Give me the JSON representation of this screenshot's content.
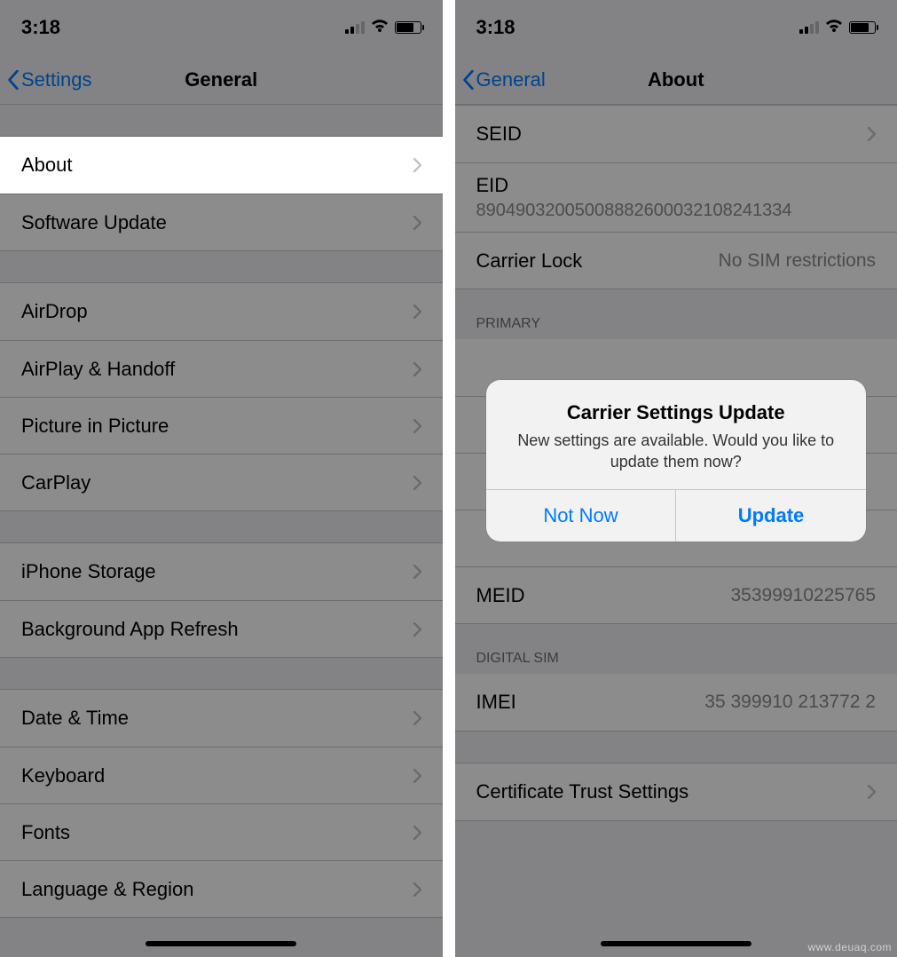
{
  "status": {
    "time": "3:18"
  },
  "left": {
    "back": "Settings",
    "title": "General",
    "rows": {
      "about": "About",
      "software_update": "Software Update",
      "airdrop": "AirDrop",
      "airplay": "AirPlay & Handoff",
      "pip": "Picture in Picture",
      "carplay": "CarPlay",
      "storage": "iPhone Storage",
      "refresh": "Background App Refresh",
      "datetime": "Date & Time",
      "keyboard": "Keyboard",
      "fonts": "Fonts",
      "lang": "Language & Region"
    }
  },
  "right": {
    "back": "General",
    "title": "About",
    "rows": {
      "seid": "SEID",
      "eid": "EID",
      "eid_value": "89049032005008882600032108241334",
      "carrier_lock": "Carrier Lock",
      "carrier_lock_value": "No SIM restrictions",
      "meid": "MEID",
      "meid_value": "35399910225765",
      "imei": "IMEI",
      "imei_value": "35 399910 213772 2",
      "cert": "Certificate Trust Settings"
    },
    "sections": {
      "primary": "PRIMARY",
      "digital_sim": "DIGITAL SIM"
    }
  },
  "modal": {
    "title": "Carrier Settings Update",
    "message": "New settings are available.  Would you like to update them now?",
    "not_now": "Not Now",
    "update": "Update"
  },
  "watermark": "www.deuaq.com"
}
